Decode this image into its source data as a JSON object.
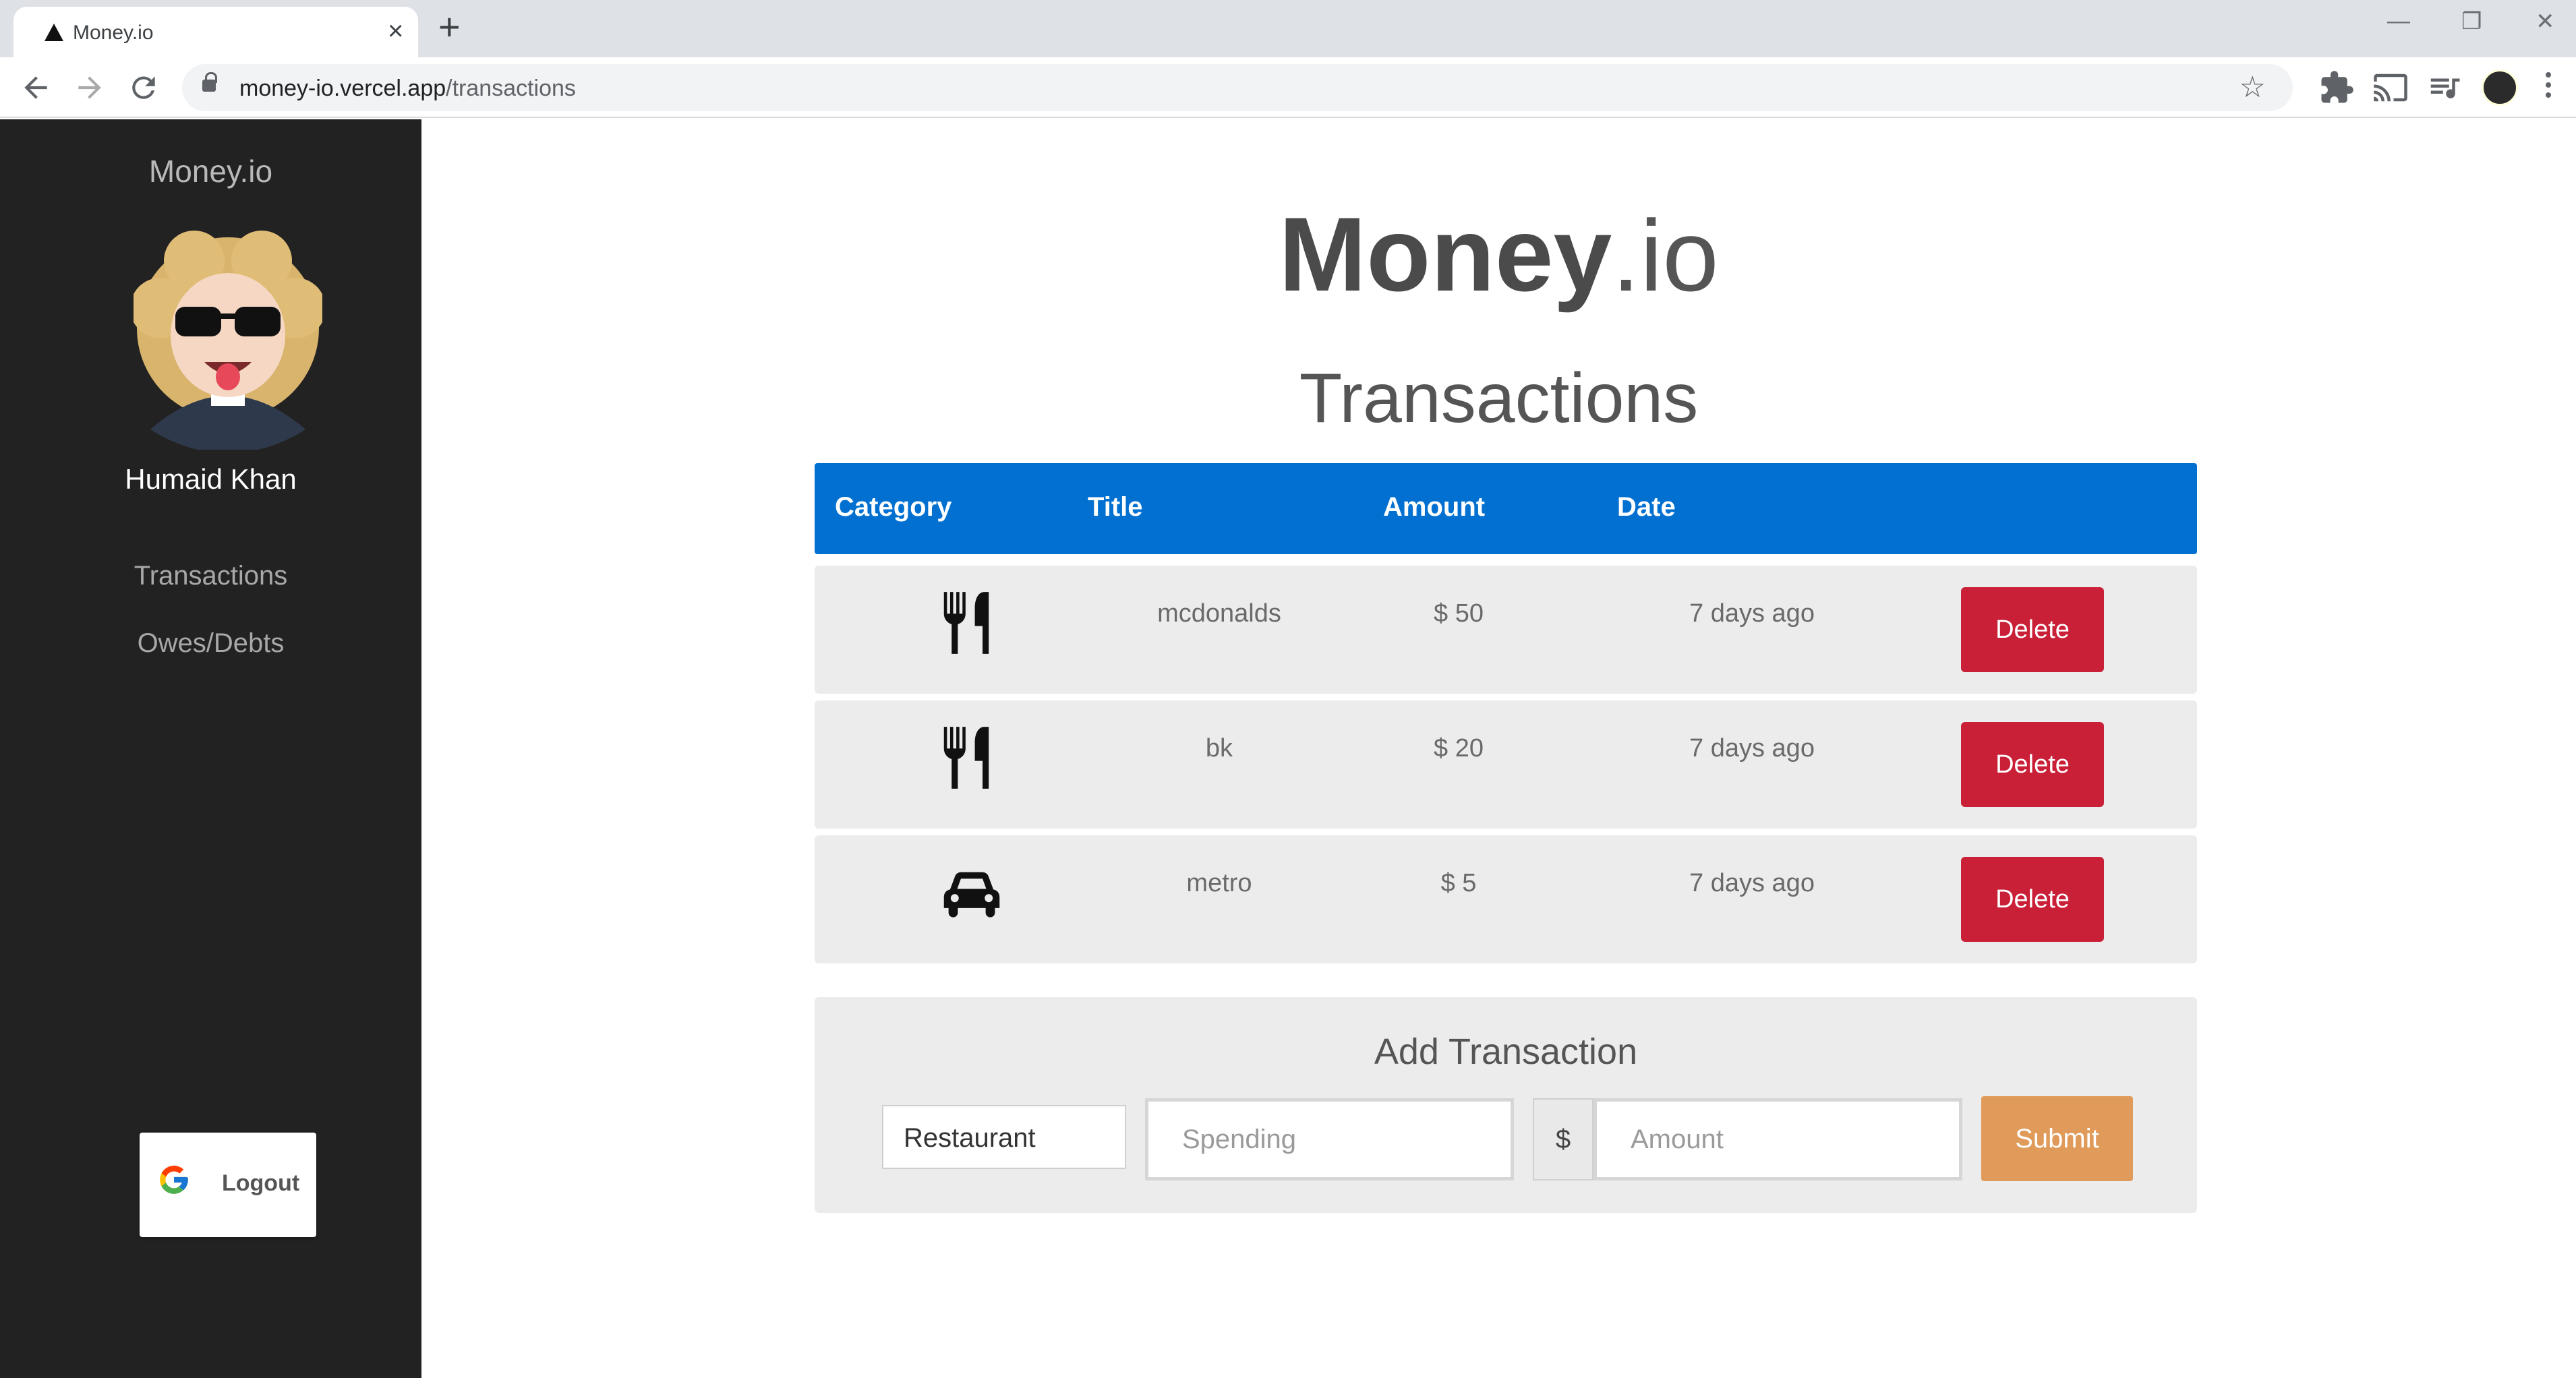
{
  "browser": {
    "tab_title": "Money.io",
    "url_host": "money-io.vercel.app",
    "url_path": "/transactions"
  },
  "sidebar": {
    "brand": "Money.io",
    "user_name": "Humaid Khan",
    "links": [
      "Transactions",
      "Owes/Debts"
    ],
    "logout_label": "Logout"
  },
  "main": {
    "logo_bold": "Money",
    "logo_light": ".io",
    "heading": "Transactions",
    "columns": [
      "Category",
      "Title",
      "Amount",
      "Date"
    ],
    "rows": [
      {
        "category_icon": "fork-knife-icon",
        "title": "mcdonalds",
        "amount": "$ 50",
        "date": "7 days ago",
        "action": "Delete"
      },
      {
        "category_icon": "fork-knife-icon",
        "title": "bk",
        "amount": "$ 20",
        "date": "7 days ago",
        "action": "Delete"
      },
      {
        "category_icon": "car-icon",
        "title": "metro",
        "amount": "$ 5",
        "date": "7 days ago",
        "action": "Delete"
      }
    ]
  },
  "form": {
    "title": "Add Transaction",
    "category_value": "Restaurant",
    "spending_placeholder": "Spending",
    "currency_symbol": "$",
    "amount_placeholder": "Amount",
    "submit_label": "Submit"
  },
  "colors": {
    "sidebar_bg": "#222222",
    "table_header": "#0270d0",
    "delete_button": "#c91f37",
    "submit_button": "#e09a5a"
  }
}
